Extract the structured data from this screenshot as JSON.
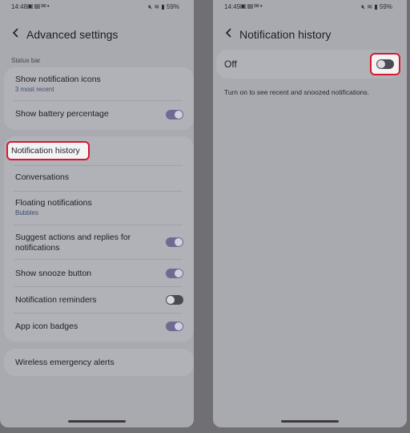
{
  "left": {
    "status": {
      "time": "14:48",
      "battery": "59%"
    },
    "header": {
      "title": "Advanced settings"
    },
    "section_status_bar": "Status bar",
    "status_card": [
      {
        "label": "Show notification icons",
        "sub": "3 most recent"
      },
      {
        "label": "Show battery percentage",
        "toggle": "on"
      }
    ],
    "main_card": [
      {
        "label": "Notification history",
        "highlighted": true
      },
      {
        "label": "Conversations"
      },
      {
        "label": "Floating notifications",
        "sub": "Bubbles"
      },
      {
        "label_line1": "Suggest actions and replies for",
        "label_line2": "notifications",
        "toggle": "on"
      },
      {
        "label": "Show snooze button",
        "toggle": "on"
      },
      {
        "label": "Notification reminders",
        "toggle": "off"
      },
      {
        "label": "App icon badges",
        "toggle": "on"
      }
    ],
    "alerts_card": {
      "label": "Wireless emergency alerts"
    }
  },
  "right": {
    "status": {
      "time": "14:49",
      "battery": "59%"
    },
    "header": {
      "title": "Notification history"
    },
    "off_label": "Off",
    "toggle": "off",
    "description": "Turn on to see recent and snoozed notifications."
  },
  "colors": {
    "highlight_border": "#d8182e",
    "toggle_on": "#6e6b92",
    "toggle_off": "#4a4a50"
  },
  "icons": [
    "back-arrow-icon",
    "gallery-icon",
    "mail-icon",
    "mute-icon",
    "wifi-icon",
    "signal-icon"
  ]
}
